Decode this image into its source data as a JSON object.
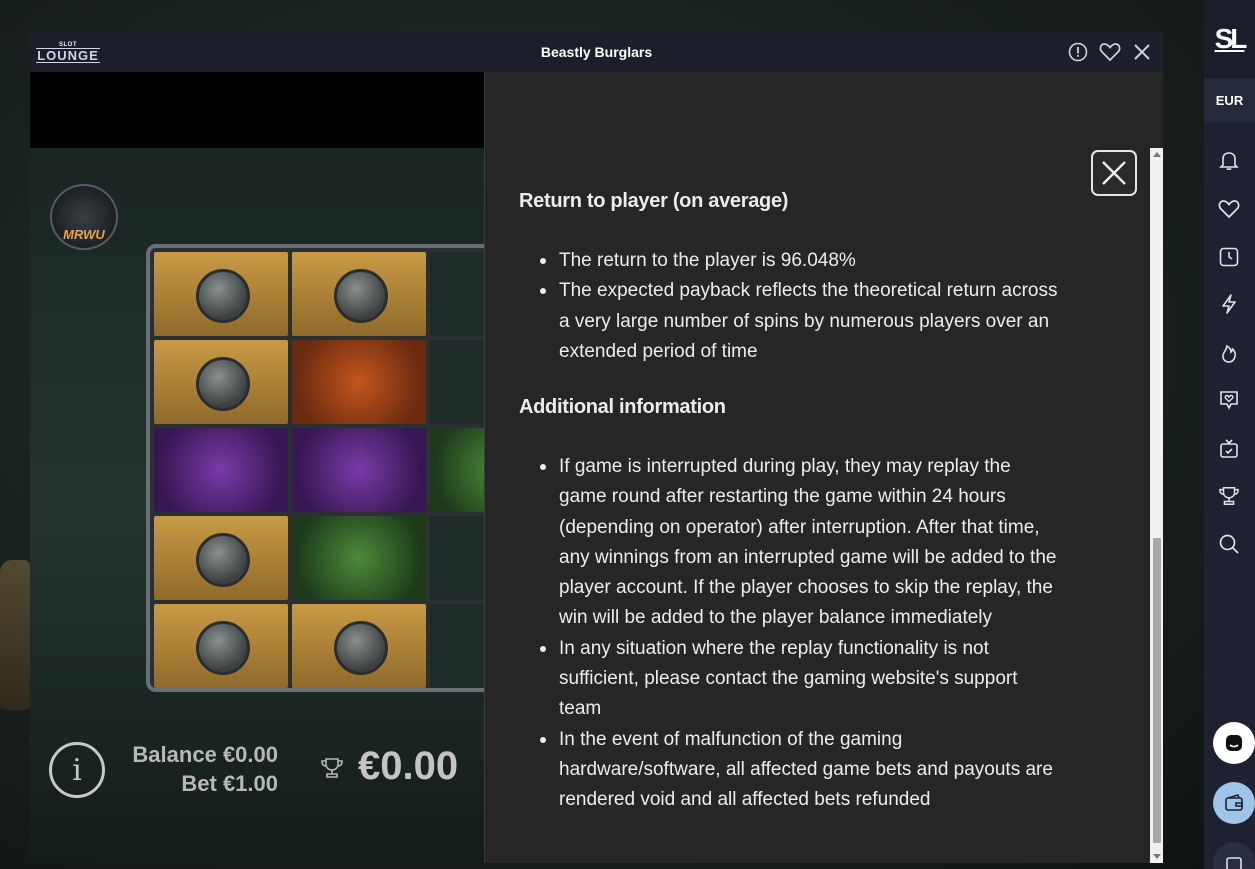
{
  "window": {
    "logo_small": "SLOT",
    "logo_big": "LOUNGE",
    "title": "Beastly Burglars"
  },
  "game": {
    "brand_badge": "MRWU",
    "balance_label": "Balance",
    "balance_value": "€0.00",
    "bet_label": "Bet",
    "bet_value": "€1.00",
    "win_value": "€0.00"
  },
  "info_panel": {
    "rtp_heading": "Return to player (on average)",
    "rtp_items": [
      "The return to the player is 96.048%",
      "The expected payback reflects the theoretical return across a very large number of spins by numerous players over an extended period of time"
    ],
    "additional_heading": "Additional information",
    "additional_items": [
      "If game is interrupted during play, they may replay the game round after restarting the game within 24 hours (depending on operator) after interruption. After that time, any winnings from an interrupted game will be added to the player account. If the player chooses to skip the replay, the win will be added to the player balance immediately",
      "In any situation where the replay functionality is not sufficient, please contact the gaming website's support team",
      "In the event of malfunction of the gaming hardware/software, all affected game bets and payouts are rendered void and all affected bets refunded"
    ]
  },
  "sidebar": {
    "logo": "SL",
    "currency": "EUR"
  },
  "colors": {
    "titlebar": "#1c1f2b",
    "panel_bg": "#262626",
    "sidebar_bg": "#1d2130",
    "accent_wallet": "#9ec4ea"
  }
}
